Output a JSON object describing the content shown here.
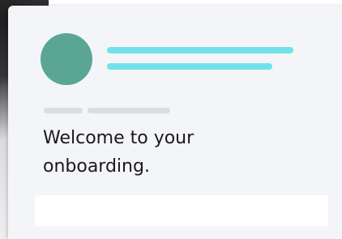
{
  "onboarding": {
    "welcome_text": "Welcome to your onboarding."
  },
  "colors": {
    "card_background": "#f4f5f9",
    "avatar": "#5ba595",
    "accent_lines": "#73e1ea",
    "skeleton_tags": "#dcdde0",
    "text": "#1a1a1a"
  }
}
